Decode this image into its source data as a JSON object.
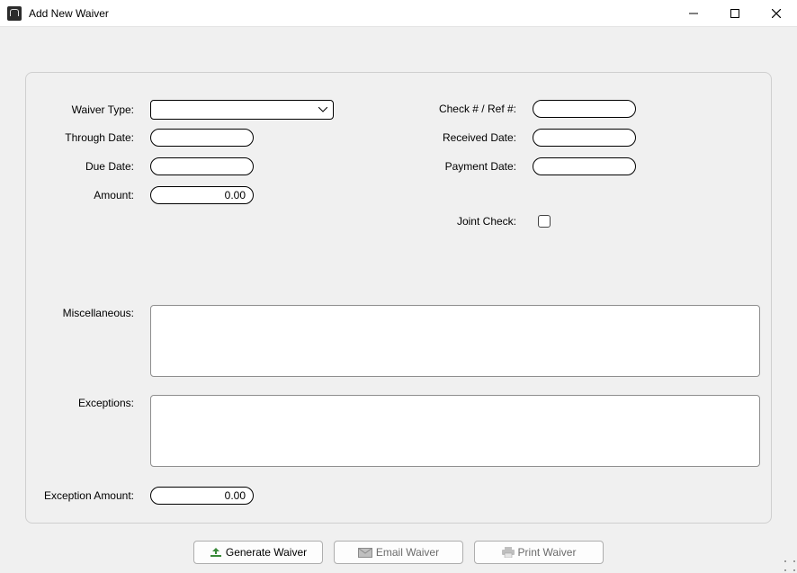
{
  "window": {
    "title": "Add New Waiver"
  },
  "labels": {
    "waiver_type": "Waiver Type:",
    "through_date": "Through Date:",
    "due_date": "Due Date:",
    "amount": "Amount:",
    "check_ref": "Check # / Ref #:",
    "received_date": "Received Date:",
    "payment_date": "Payment Date:",
    "joint_check": "Joint Check:",
    "miscellaneous": "Miscellaneous:",
    "exceptions": "Exceptions:",
    "exception_amount": "Exception Amount:"
  },
  "values": {
    "waiver_type": "",
    "through_date": "",
    "due_date": "",
    "amount": "0.00",
    "check_ref": "",
    "received_date": "",
    "payment_date": "",
    "joint_check": false,
    "miscellaneous": "",
    "exceptions": "",
    "exception_amount": "0.00"
  },
  "buttons": {
    "generate": "Generate Waiver",
    "email": "Email Waiver",
    "print": "Print Waiver"
  }
}
